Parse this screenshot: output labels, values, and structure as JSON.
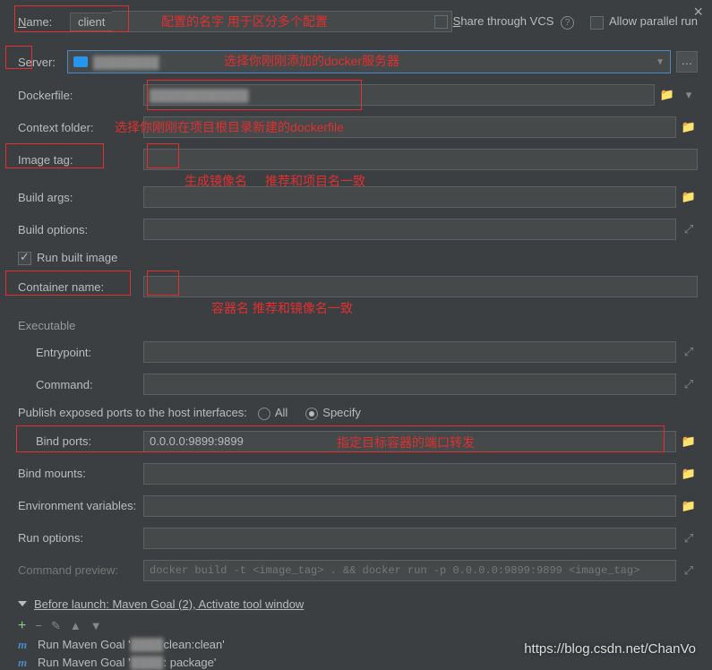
{
  "close": "×",
  "name_label": "Name:",
  "name_value": "client",
  "share_vcs": "Share through VCS",
  "allow_parallel": "Allow parallel run",
  "annotations": {
    "name_tip": "配置的名字 用于区分多个配置",
    "server_tip": "选择你刚刚添加的docker服务器",
    "dockerfile_tip": "选择你刚刚在项目根目录新建的dockerfile",
    "image_tip1": "生成镜像名",
    "image_tip2": "推荐和项目名一致",
    "container_tip": "容器名 推荐和镜像名一致",
    "bindports_tip": "指定目标容器的端口转发"
  },
  "labels": {
    "server": "Server:",
    "dockerfile": "Dockerfile:",
    "context": "Context folder:",
    "imagetag": "Image tag:",
    "buildargs": "Build args:",
    "buildopts": "Build options:",
    "runbuilt": "Run built image",
    "container": "Container name:",
    "executable": "Executable",
    "entrypoint": "Entrypoint:",
    "command": "Command:",
    "publish": "Publish exposed ports to the host interfaces:",
    "all": "All",
    "specify": "Specify",
    "bindports": "Bind ports:",
    "bindmounts": "Bind mounts:",
    "envvars": "Environment variables:",
    "runopts": "Run options:",
    "cmdpreview": "Command preview:"
  },
  "bind_ports_value": "0.0.0.0:9899:9899",
  "command_preview": "docker build -t <image_tag> . && docker run -p 0.0.0.0:9899:9899 <image_tag>",
  "before_launch": "Before launch: Maven Goal (2), Activate tool window",
  "maven1": "Run Maven Goal '",
  "maven1_suffix": " clean:clean'",
  "maven2": "Run Maven Goal '",
  "maven2_suffix": ": package'",
  "watermark": "https://blog.csdn.net/ChanVo"
}
